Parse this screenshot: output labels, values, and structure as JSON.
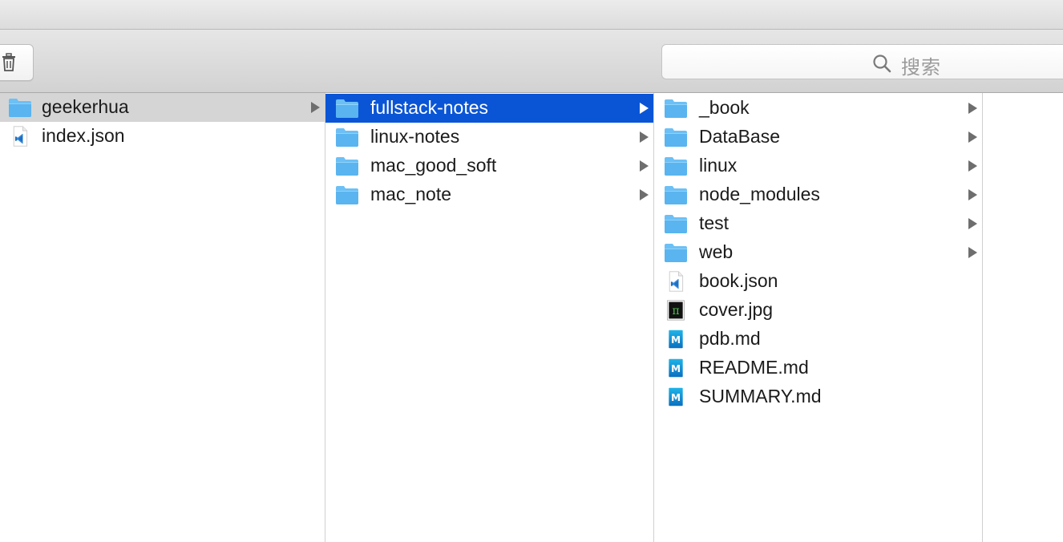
{
  "toolbar": {
    "search_placeholder": "搜索"
  },
  "columns": [
    {
      "items": [
        {
          "label": "geekerhua",
          "icon": "folder-icon",
          "arrow": true,
          "selected": "grey"
        },
        {
          "label": "index.json",
          "icon": "vscode-file-icon",
          "arrow": false,
          "selected": ""
        }
      ]
    },
    {
      "items": [
        {
          "label": "fullstack-notes",
          "icon": "folder-icon",
          "arrow": true,
          "selected": "blue"
        },
        {
          "label": "linux-notes",
          "icon": "folder-icon",
          "arrow": true,
          "selected": ""
        },
        {
          "label": "mac_good_soft",
          "icon": "folder-icon",
          "arrow": true,
          "selected": ""
        },
        {
          "label": "mac_note",
          "icon": "folder-icon",
          "arrow": true,
          "selected": ""
        }
      ]
    },
    {
      "items": [
        {
          "label": "_book",
          "icon": "folder-icon",
          "arrow": true,
          "selected": ""
        },
        {
          "label": "DataBase",
          "icon": "folder-icon",
          "arrow": true,
          "selected": ""
        },
        {
          "label": "linux",
          "icon": "folder-icon",
          "arrow": true,
          "selected": ""
        },
        {
          "label": "node_modules",
          "icon": "folder-icon",
          "arrow": true,
          "selected": ""
        },
        {
          "label": "test",
          "icon": "folder-icon",
          "arrow": true,
          "selected": ""
        },
        {
          "label": "web",
          "icon": "folder-icon",
          "arrow": true,
          "selected": ""
        },
        {
          "label": "book.json",
          "icon": "vscode-file-icon",
          "arrow": false,
          "selected": ""
        },
        {
          "label": "cover.jpg",
          "icon": "image-thumbnail-icon",
          "arrow": false,
          "selected": ""
        },
        {
          "label": "pdb.md",
          "icon": "markdown-file-icon",
          "arrow": false,
          "selected": ""
        },
        {
          "label": "README.md",
          "icon": "markdown-file-icon",
          "arrow": false,
          "selected": ""
        },
        {
          "label": "SUMMARY.md",
          "icon": "markdown-file-icon",
          "arrow": false,
          "selected": ""
        }
      ]
    }
  ],
  "colors": {
    "selection_blue": "#0a55d6",
    "selection_grey": "#d5d5d5",
    "folder_blue": "#5fb8f2"
  }
}
